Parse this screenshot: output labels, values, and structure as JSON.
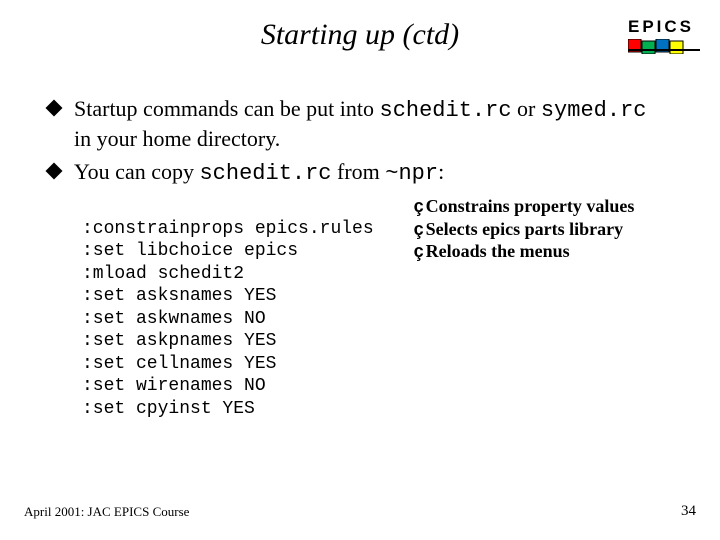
{
  "title": "Starting up (ctd)",
  "brand": "EPICS",
  "logo_colors": {
    "red": "#ff0000",
    "green": "#00b050",
    "blue": "#0070c0",
    "yellow": "#ffff00"
  },
  "bullets": [
    {
      "pre": "Startup commands can be put into ",
      "code1": "schedit.rc",
      "mid": " or ",
      "code2": "symed.rc",
      "post": " in your home directory."
    },
    {
      "pre": "You can copy ",
      "code1": "schedit.rc",
      "mid": " from ",
      "code2": "~npr",
      "post": ":"
    }
  ],
  "code": [
    ":constrainprops epics.rules",
    ":set libchoice epics",
    ":mload schedit2",
    ":set asksnames YES",
    ":set askwnames NO",
    ":set askpnames YES",
    ":set cellnames YES",
    ":set wirenames NO",
    ":set cpyinst YES"
  ],
  "annotations": [
    "Constrains property values",
    "Selects epics parts library",
    "Reloads the menus"
  ],
  "footer_left": "April 2001: JAC EPICS Course",
  "footer_right": "34"
}
